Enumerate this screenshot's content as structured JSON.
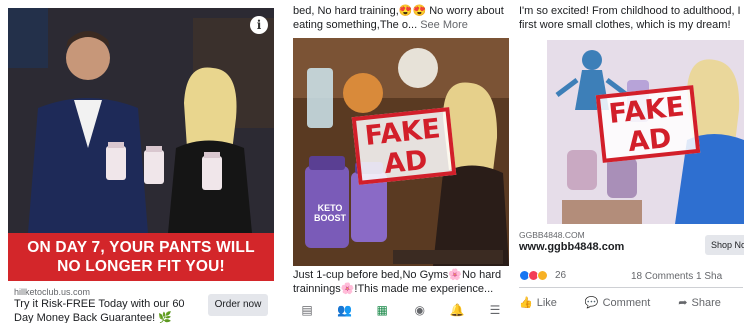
{
  "panel1": {
    "banner_line1": "ON DAY 7, YOUR PANTS WILL",
    "banner_line2": "NO LONGER FIT YOU!",
    "domain": "hillketoclub.us.com",
    "cta_text": "Try it Risk-FREE Today with our 60 Day Money Back Guarantee! 🌿",
    "button_label": "Order now",
    "info_icon": "i"
  },
  "panel2": {
    "caption_top": "bed, No hard training,😍😍 No worry about eating something,The o...",
    "see_more": "See More",
    "stamp_line1": "FAKE",
    "stamp_line2": "AD",
    "product_text": "KETO BOOST",
    "caption_bottom": "Just 1-cup before bed,No Gyms🌸No hard trainnings🌸!This made me experience..."
  },
  "panel3": {
    "caption": "I'm so excited! From childhood to adulthood, I first wore small clothes, which is my dream!",
    "stamp_line1": "FAKE",
    "stamp_line2": "AD",
    "domain": "GGBB4848.COM",
    "title": "www.ggbb4848.com",
    "button_label": "Shop Now",
    "reaction_count": "26",
    "comments": "18 Comments  1 Sha",
    "like_label": "Like",
    "comment_label": "Comment",
    "share_label": "Share"
  },
  "colors": {
    "banner_red": "#d3262a",
    "stamp_red": "#d21f2a",
    "fb_grey": "#65676b"
  }
}
